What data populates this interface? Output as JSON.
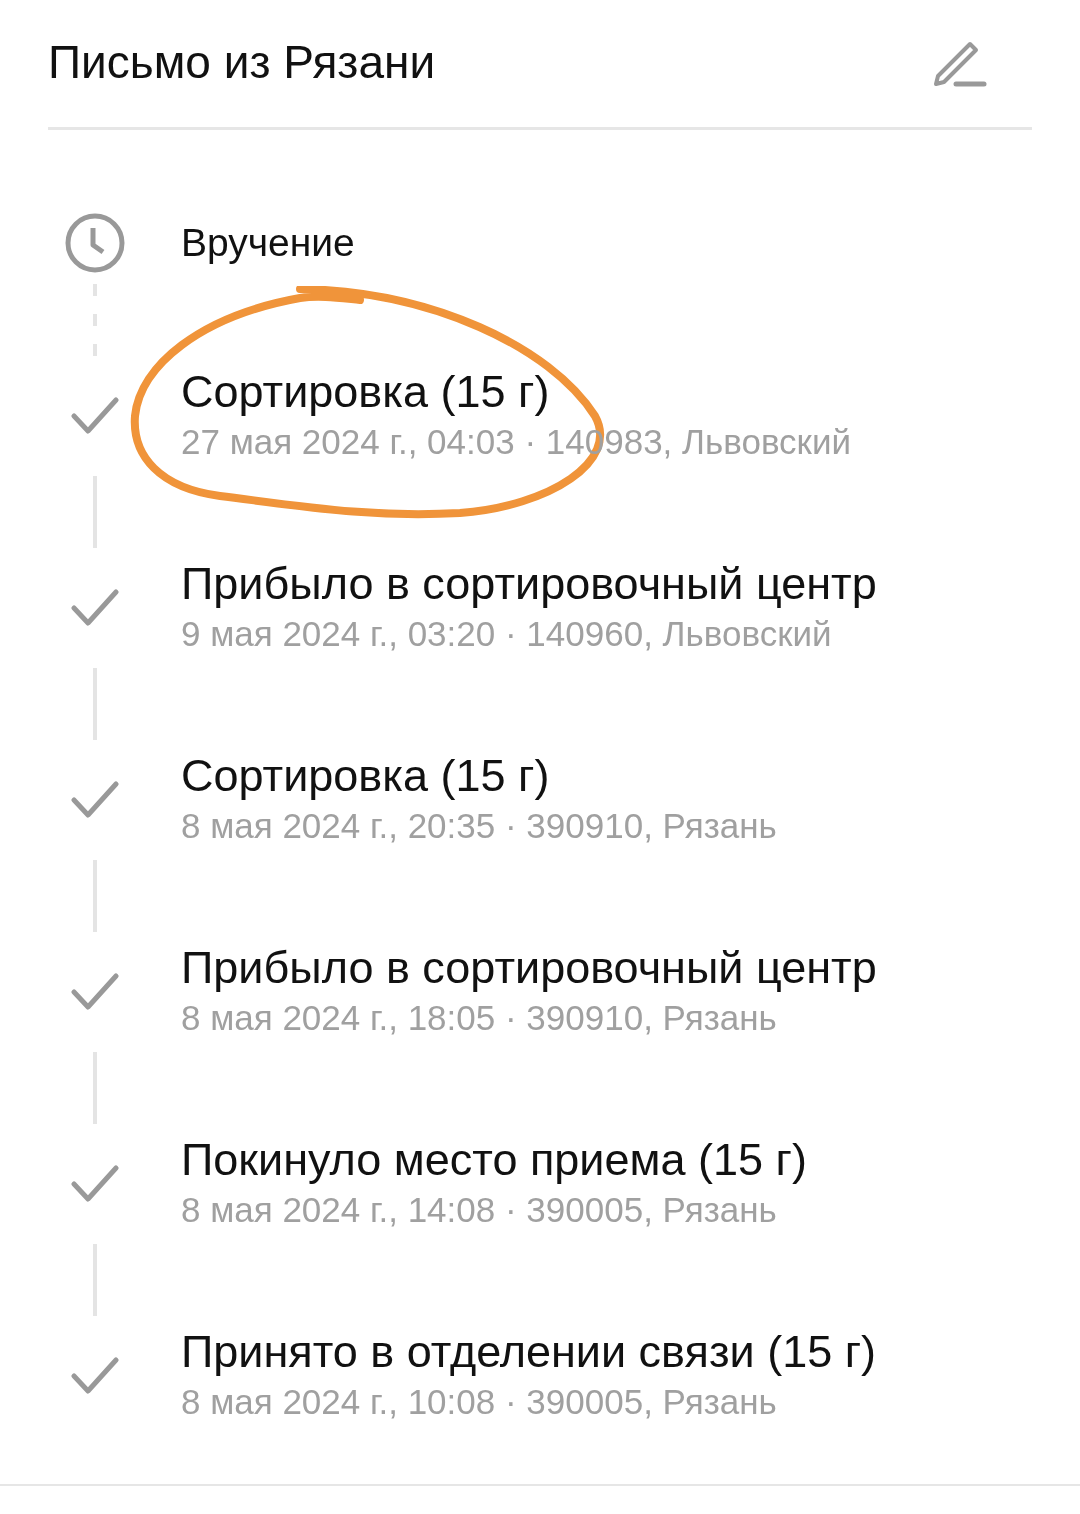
{
  "header": {
    "title": "Письмо из Рязани"
  },
  "steps": [
    {
      "kind": "pending",
      "title": "Вручение",
      "circled": false
    },
    {
      "kind": "done",
      "title": "Сортировка (15 г)",
      "details": "27 мая 2024 г., 04:03 · 140983, Львовский",
      "circled": true
    },
    {
      "kind": "done",
      "title": "Прибыло в сортировочный центр",
      "details": "9 мая 2024 г., 03:20 · 140960, Львовский",
      "circled": false
    },
    {
      "kind": "done",
      "title": "Сортировка (15 г)",
      "details": "8 мая 2024 г., 20:35 · 390910, Рязань",
      "circled": false
    },
    {
      "kind": "done",
      "title": "Прибыло в сортировочный центр",
      "details": "8 мая 2024 г., 18:05 · 390910, Рязань",
      "circled": false
    },
    {
      "kind": "done",
      "title": "Покинуло место приема (15 г)",
      "details": "8 мая 2024 г., 14:08 · 390005, Рязань",
      "circled": false
    },
    {
      "kind": "done",
      "title": "Принято в отделении связи (15 г)",
      "details": "8 мая 2024 г., 10:08 · 390005, Рязань",
      "circled": false
    }
  ]
}
